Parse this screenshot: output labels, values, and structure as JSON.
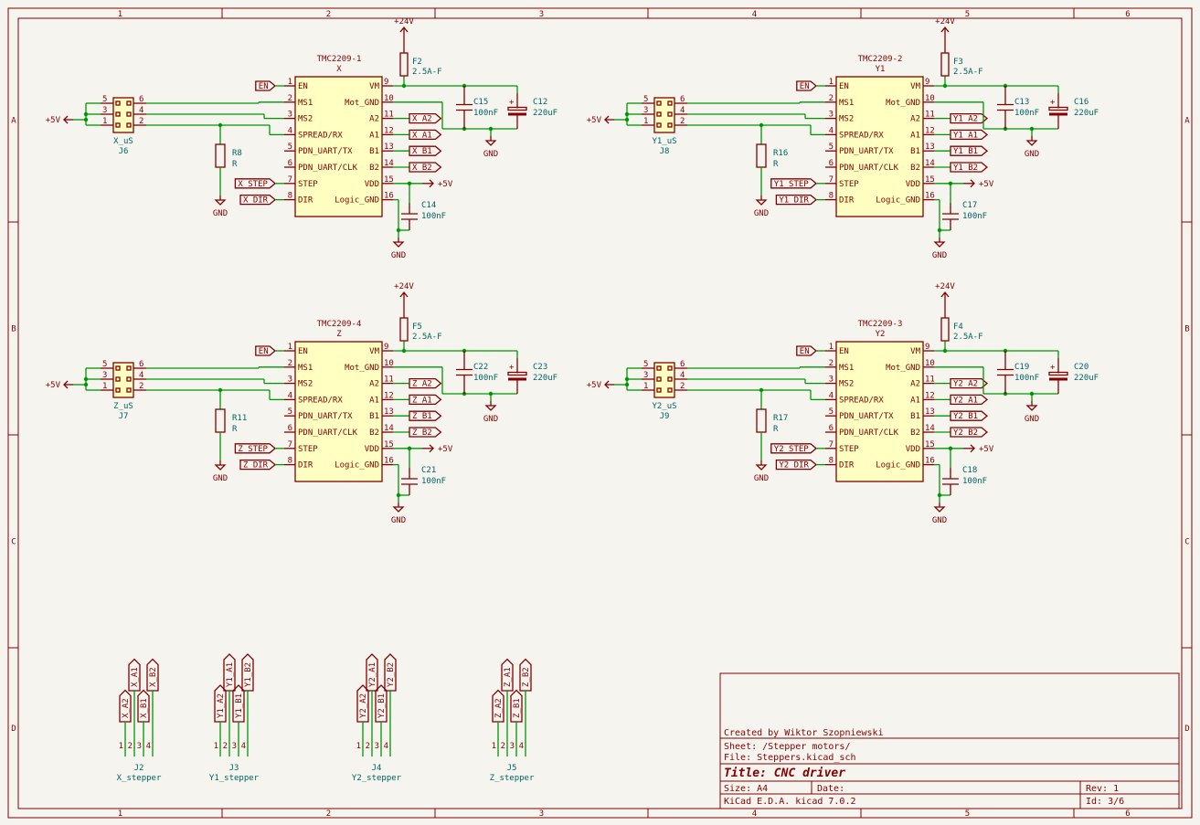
{
  "frame": {
    "columns": [
      "1",
      "2",
      "3",
      "4",
      "5",
      "6"
    ],
    "rows": [
      "A",
      "B",
      "C",
      "D"
    ]
  },
  "symbols": {
    "p24": "+24V",
    "p5": "+5V",
    "gnd": "GND"
  },
  "drivers": [
    {
      "part": "TMC2209-1",
      "axis": "X",
      "fuse_ref": "F2",
      "fuse_val": "2.5A-F",
      "cap_mot_ref": "C15",
      "cap_mot_val": "100nF",
      "cap_bulk_ref": "C12",
      "cap_bulk_val": "220uF",
      "cap_log_ref": "C14",
      "cap_log_val": "100nF",
      "res_ref": "R8",
      "res_val": "R",
      "header_ref": "J6",
      "header_val": "X_uS",
      "step": "X_STEP",
      "dir": "X_DIR",
      "en": "EN",
      "outs": [
        "X_A2",
        "X_A1",
        "X_B1",
        "X_B2"
      ]
    },
    {
      "part": "TMC2209-2",
      "axis": "Y1",
      "fuse_ref": "F3",
      "fuse_val": "2.5A-F",
      "cap_mot_ref": "C13",
      "cap_mot_val": "100nF",
      "cap_bulk_ref": "C16",
      "cap_bulk_val": "220uF",
      "cap_log_ref": "C17",
      "cap_log_val": "100nF",
      "res_ref": "R16",
      "res_val": "R",
      "header_ref": "J8",
      "header_val": "Y1_uS",
      "step": "Y1_STEP",
      "dir": "Y1_DIR",
      "en": "EN",
      "outs": [
        "Y1_A2",
        "Y1_A1",
        "Y1_B1",
        "Y1_B2"
      ]
    },
    {
      "part": "TMC2209-4",
      "axis": "Z",
      "fuse_ref": "F5",
      "fuse_val": "2.5A-F",
      "cap_mot_ref": "C22",
      "cap_mot_val": "100nF",
      "cap_bulk_ref": "C23",
      "cap_bulk_val": "220uF",
      "cap_log_ref": "C21",
      "cap_log_val": "100nF",
      "res_ref": "R11",
      "res_val": "R",
      "header_ref": "J7",
      "header_val": "Z_uS",
      "step": "Z_STEP",
      "dir": "Z_DIR",
      "en": "EN",
      "outs": [
        "Z_A2",
        "Z_A1",
        "Z_B1",
        "Z_B2"
      ]
    },
    {
      "part": "TMC2209-3",
      "axis": "Y2",
      "fuse_ref": "F4",
      "fuse_val": "2.5A-F",
      "cap_mot_ref": "C19",
      "cap_mot_val": "100nF",
      "cap_bulk_ref": "C20",
      "cap_bulk_val": "220uF",
      "cap_log_ref": "C18",
      "cap_log_val": "100nF",
      "res_ref": "R17",
      "res_val": "R",
      "header_ref": "J9",
      "header_val": "Y2_uS",
      "step": "Y2_STEP",
      "dir": "Y2_DIR",
      "en": "EN",
      "outs": [
        "Y2_A2",
        "Y2_A1",
        "Y2_B1",
        "Y2_B2"
      ]
    }
  ],
  "pins": {
    "left_names": [
      "EN",
      "MS1",
      "MS2",
      "SPREAD/RX",
      "PDN_UART/TX",
      "PDN_UART/CLK",
      "STEP",
      "DIR"
    ],
    "left_nums": [
      "1",
      "2",
      "3",
      "4",
      "5",
      "6",
      "7",
      "8"
    ],
    "right_names": [
      "VM",
      "Mot_GND",
      "A2",
      "A1",
      "B1",
      "B2",
      "VDD",
      "Logic_GND"
    ],
    "right_nums": [
      "9",
      "10",
      "11",
      "12",
      "13",
      "14",
      "15",
      "16"
    ],
    "header_nums_left": [
      "5",
      "3",
      "1"
    ],
    "header_nums_right": [
      "6",
      "4",
      "2"
    ]
  },
  "steppers": [
    {
      "ref": "J2",
      "val": "X_stepper",
      "nets": [
        "X_A2",
        "X_A1",
        "X_B1",
        "X_B2"
      ]
    },
    {
      "ref": "J3",
      "val": "Y1_stepper",
      "nets": [
        "Y1_A2",
        "Y1_A1",
        "Y1_B1",
        "Y1_B2"
      ]
    },
    {
      "ref": "J4",
      "val": "Y2_stepper",
      "nets": [
        "Y2_A2",
        "Y2_A1",
        "Y2_B1",
        "Y2_B2"
      ]
    },
    {
      "ref": "J5",
      "val": "Z_stepper",
      "nets": [
        "Z_A2",
        "Z_A1",
        "Z_B1",
        "Z_B2"
      ]
    }
  ],
  "stepper_pins": [
    "1",
    "2",
    "3",
    "4"
  ],
  "title_block": {
    "created": "Created by Wiktor Szopniewski",
    "sheet": "Sheet: /Stepper motors/",
    "file": "File: Steppers.kicad_sch",
    "title": "Title: CNC driver",
    "size": "Size: A4",
    "date": "Date:",
    "rev": "Rev: 1",
    "tool": "KiCad E.D.A.  kicad 7.0.2",
    "id": "Id: 3/6"
  }
}
